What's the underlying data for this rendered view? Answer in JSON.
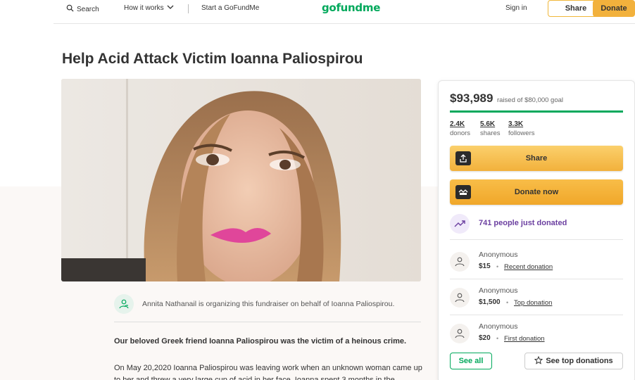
{
  "header": {
    "search_label": "Search",
    "how_it_works_label": "How it works",
    "start_label": "Start a GoFundMe",
    "logo_text": "gofundme",
    "signin_label": "Sign in",
    "share_label": "Share",
    "donate_label": "Donate"
  },
  "campaign": {
    "title": "Help Acid Attack Victim Ioanna Paliospirou",
    "organizer_text": "Annita Nathanail is organizing this fundraiser on behalf of Ioanna Paliospirou.",
    "story_lead": "Our beloved Greek friend Ioanna Paliospirou was the victim of a heinous crime.",
    "story_body": "On May 20,2020 Ioanna Paliospirou was leaving work when an unknown woman came up to her and threw a very large cup of acid in her face. Ioanna spent 3 months in the"
  },
  "sidebar": {
    "raised": "$93,989",
    "goal_text": "raised of $80,000 goal",
    "progress_fraction": 1.0,
    "stats": [
      {
        "value": "2.4K",
        "label": "donors"
      },
      {
        "value": "5.6K",
        "label": "shares"
      },
      {
        "value": "3.3K",
        "label": "followers"
      }
    ],
    "share_button": "Share",
    "donate_button": "Donate now",
    "trend_text": "741 people just donated",
    "donations": [
      {
        "name": "Anonymous",
        "amount": "$15",
        "tag": "Recent donation"
      },
      {
        "name": "Anonymous",
        "amount": "$1,500",
        "tag": "Top donation"
      },
      {
        "name": "Anonymous",
        "amount": "$20",
        "tag": "First donation"
      }
    ],
    "see_all": "See all",
    "see_top": "See top donations"
  },
  "colors": {
    "brand_green": "#02a95c",
    "accent_yellow": "#f2b13c",
    "trend_purple": "#6b3fa0"
  }
}
